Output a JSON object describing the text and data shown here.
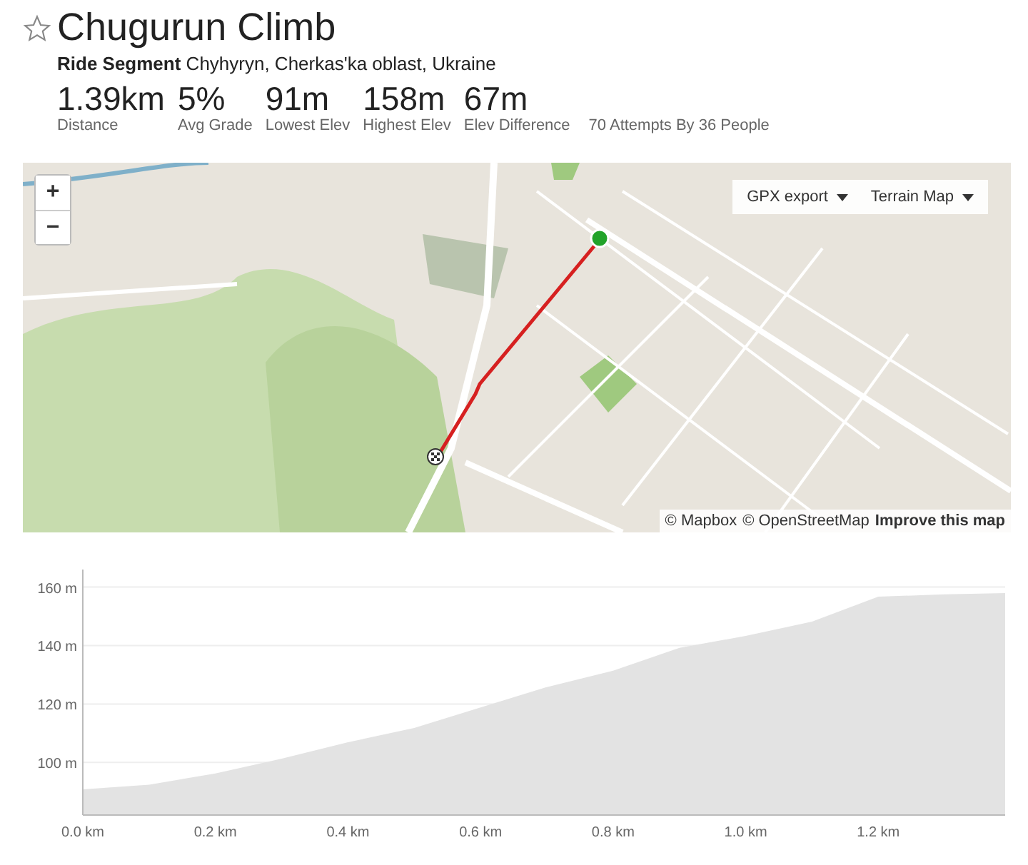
{
  "segment": {
    "title": "Chugurun Climb",
    "starred": false,
    "type": "Ride Segment",
    "location": "Chyhyryn, Cherkas'ka oblast, Ukraine"
  },
  "stats": [
    {
      "value": "1.39km",
      "label": "Distance"
    },
    {
      "value": "5%",
      "label": "Avg Grade"
    },
    {
      "value": "91m",
      "label": "Lowest Elev"
    },
    {
      "value": "158m",
      "label": "Highest Elev"
    },
    {
      "value": "67m",
      "label": "Elev Difference"
    }
  ],
  "attempts": "70 Attempts By 36 People",
  "map": {
    "kind": "picture",
    "zoom_in": "+",
    "zoom_out": "−",
    "menus": [
      {
        "label": "GPX export"
      },
      {
        "label": "Terrain Map"
      }
    ],
    "attribution": [
      {
        "text": "© Mapbox",
        "bold": false
      },
      {
        "text": "© OpenStreetMap",
        "bold": false
      },
      {
        "text": "Improve this map",
        "bold": true
      }
    ]
  },
  "elevation": {
    "chart_data": {
      "type": "area",
      "x": [
        0,
        0.1,
        0.2,
        0.3,
        0.4,
        0.5,
        0.6,
        0.7,
        0.8,
        0.9,
        1.0,
        1.1,
        1.2,
        1.3,
        1.4
      ],
      "grid": true,
      "series": [
        {
          "color": "#e3e3e3",
          "values": [
            90.8,
            92.4,
            96.2,
            101.3,
            106.9,
            111.8,
            118.8,
            125.8,
            131.4,
            139.2,
            143.3,
            148.2,
            156.7,
            157.5,
            158
          ]
        }
      ],
      "xlim": [
        0,
        1.4
      ],
      "ylim": [
        82,
        166
      ],
      "xticks": [
        {
          "value": 0,
          "label": "0.0 km"
        },
        {
          "value": 0.2,
          "label": "0.2 km"
        },
        {
          "value": 0.4,
          "label": "0.4 km"
        },
        {
          "value": 0.6,
          "label": "0.6 km"
        },
        {
          "value": 0.8,
          "label": "0.8 km"
        },
        {
          "value": 1.0,
          "label": "1.0 km"
        },
        {
          "value": 1.2,
          "label": "1.2 km"
        }
      ],
      "yticks": [
        {
          "value": 100,
          "label": "100 m"
        },
        {
          "value": 120,
          "label": "120 m"
        },
        {
          "value": 140,
          "label": "140 m"
        },
        {
          "value": 160,
          "label": "160 m"
        }
      ]
    }
  }
}
